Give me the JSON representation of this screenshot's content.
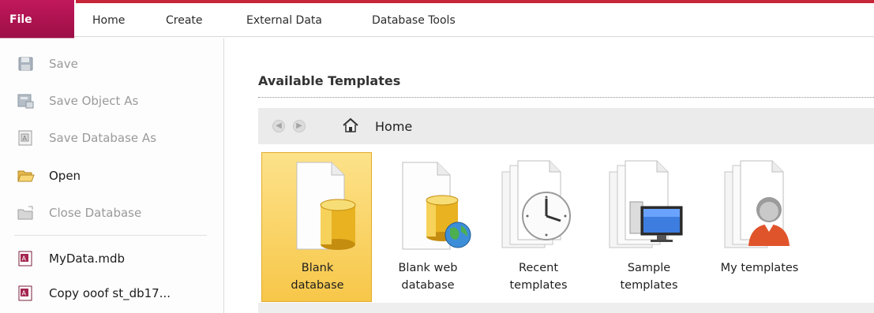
{
  "ribbon": {
    "file_label": "File",
    "tabs": [
      "Home",
      "Create",
      "External Data",
      "Database Tools"
    ]
  },
  "backstage": {
    "commands": [
      {
        "label": "Save",
        "enabled": false,
        "icon": "floppy-disk-icon"
      },
      {
        "label": "Save Object As",
        "enabled": false,
        "icon": "save-object-icon"
      },
      {
        "label": "Save Database As",
        "enabled": false,
        "icon": "save-database-icon"
      },
      {
        "label": "Open",
        "enabled": true,
        "icon": "folder-open-icon"
      },
      {
        "label": "Close Database",
        "enabled": false,
        "icon": "close-folder-icon"
      }
    ],
    "recent_files": [
      {
        "label": "MyData.mdb",
        "icon": "access-file-icon"
      },
      {
        "label": "Copy ooof st_db17...",
        "icon": "access-file-icon"
      }
    ]
  },
  "templates": {
    "section_title": "Available Templates",
    "nav": {
      "location": "Home",
      "back_icon": "back-arrow-icon",
      "forward_icon": "forward-arrow-icon",
      "home_icon": "home-icon"
    },
    "items": [
      {
        "line1": "Blank",
        "line2": "database",
        "selected": true,
        "icon": "blank-database-icon"
      },
      {
        "line1": "Blank web",
        "line2": "database",
        "selected": false,
        "icon": "blank-web-database-icon"
      },
      {
        "line1": "Recent",
        "line2": "templates",
        "selected": false,
        "icon": "recent-templates-clock-icon"
      },
      {
        "line1": "Sample",
        "line2": "templates",
        "selected": false,
        "icon": "sample-templates-monitor-icon"
      },
      {
        "line1": "My templates",
        "line2": "",
        "selected": false,
        "icon": "my-templates-person-icon"
      }
    ]
  },
  "colors": {
    "file_tab": "#b3124f",
    "ribbon_accent": "#c72538",
    "selection": "#f9d36a"
  }
}
